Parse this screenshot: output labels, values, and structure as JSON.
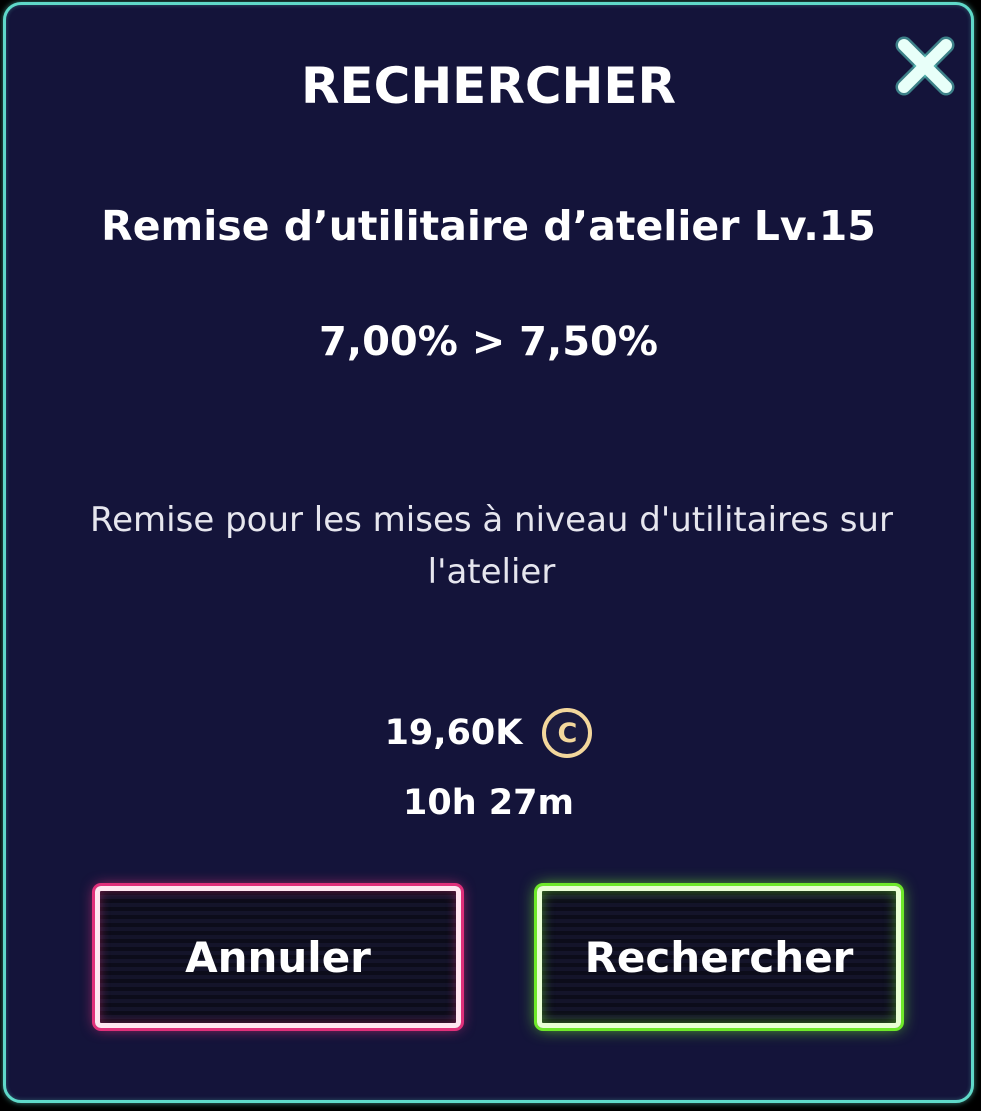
{
  "dialog": {
    "title": "RECHERCHER",
    "upgrade_name": "Remise d’utilitaire d’atelier Lv.15",
    "value_change": "7,00% > 7,50%",
    "description": "Remise pour les mises à niveau d'utilitaires sur l'atelier",
    "cost": {
      "amount": "19,60K",
      "currency_symbol": "C",
      "currency_icon": "coin-icon"
    },
    "duration": "10h 27m",
    "close_icon": "close-icon"
  },
  "buttons": {
    "cancel_label": "Annuler",
    "confirm_label": "Rechercher"
  },
  "colors": {
    "background": "#14143a",
    "frame": "#5fd9c9",
    "close": "#e8fff9",
    "coin": "#f3d79c",
    "cancel_glow": "#e0307a",
    "confirm_glow": "#6ee82a"
  }
}
